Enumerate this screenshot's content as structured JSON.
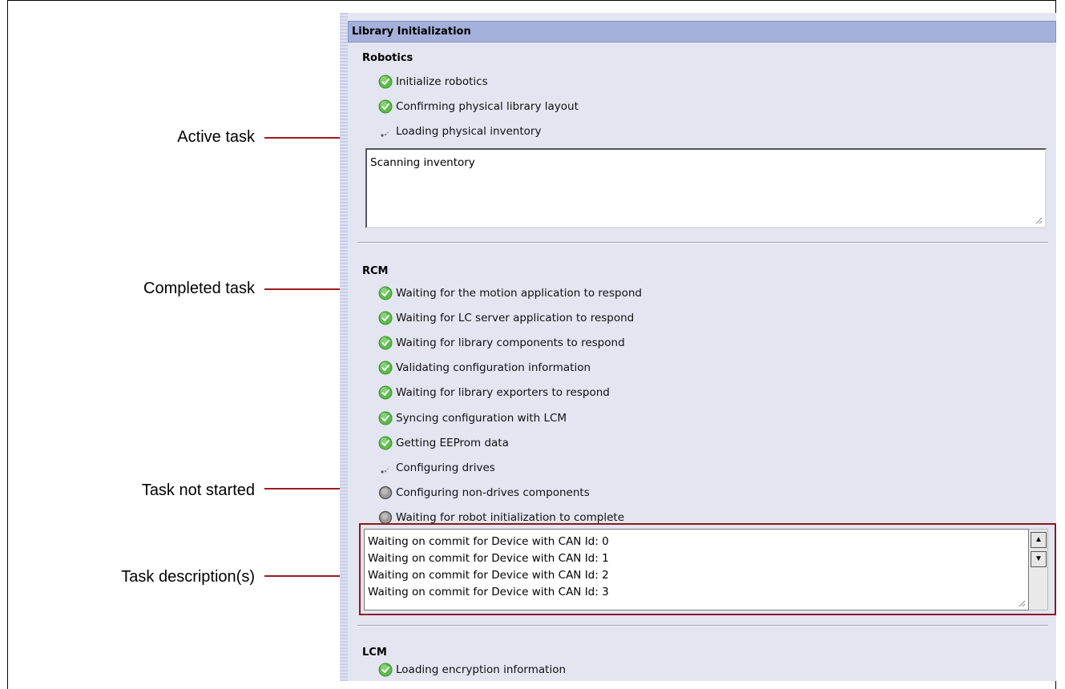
{
  "callouts": {
    "active_task": "Active task",
    "completed_task": "Completed task",
    "task_not_started": "Task not started",
    "task_descriptions": "Task description(s)"
  },
  "window": {
    "title": "Library Initialization"
  },
  "robotics": {
    "title": "Robotics",
    "tasks": [
      {
        "label": "Initialize robotics",
        "status": "completed"
      },
      {
        "label": "Confirming physical library layout",
        "status": "completed"
      },
      {
        "label": "Loading physical inventory",
        "status": "active"
      }
    ],
    "description": "Scanning inventory"
  },
  "rcm": {
    "title": "RCM",
    "tasks": [
      {
        "label": "Waiting for the motion application to respond",
        "status": "completed"
      },
      {
        "label": "Waiting for LC server application to respond",
        "status": "completed"
      },
      {
        "label": "Waiting for library components to respond",
        "status": "completed"
      },
      {
        "label": "Validating configuration information",
        "status": "completed"
      },
      {
        "label": "Waiting for library exporters to respond",
        "status": "completed"
      },
      {
        "label": "Syncing configuration with LCM",
        "status": "completed"
      },
      {
        "label": "Getting EEProm data",
        "status": "completed"
      },
      {
        "label": "Configuring drives",
        "status": "active"
      },
      {
        "label": "Configuring non-drives components",
        "status": "not_started"
      },
      {
        "label": "Waiting for robot initialization to complete",
        "status": "not_started"
      }
    ],
    "description_lines": [
      "Waiting on commit for Device with CAN Id: 0",
      "Waiting on commit for Device with CAN Id: 1",
      "Waiting on commit for Device with CAN Id: 2",
      "Waiting on commit for Device with CAN Id: 3"
    ]
  },
  "lcm": {
    "title": "LCM",
    "tasks": [
      {
        "label": "Loading encryption information",
        "status": "completed"
      }
    ]
  },
  "colors": {
    "title_bar": "#a5b1db",
    "panel_bg": "#e3e5f1",
    "callout_arrow": "#9b1c1c",
    "check_green": "#58b848"
  }
}
